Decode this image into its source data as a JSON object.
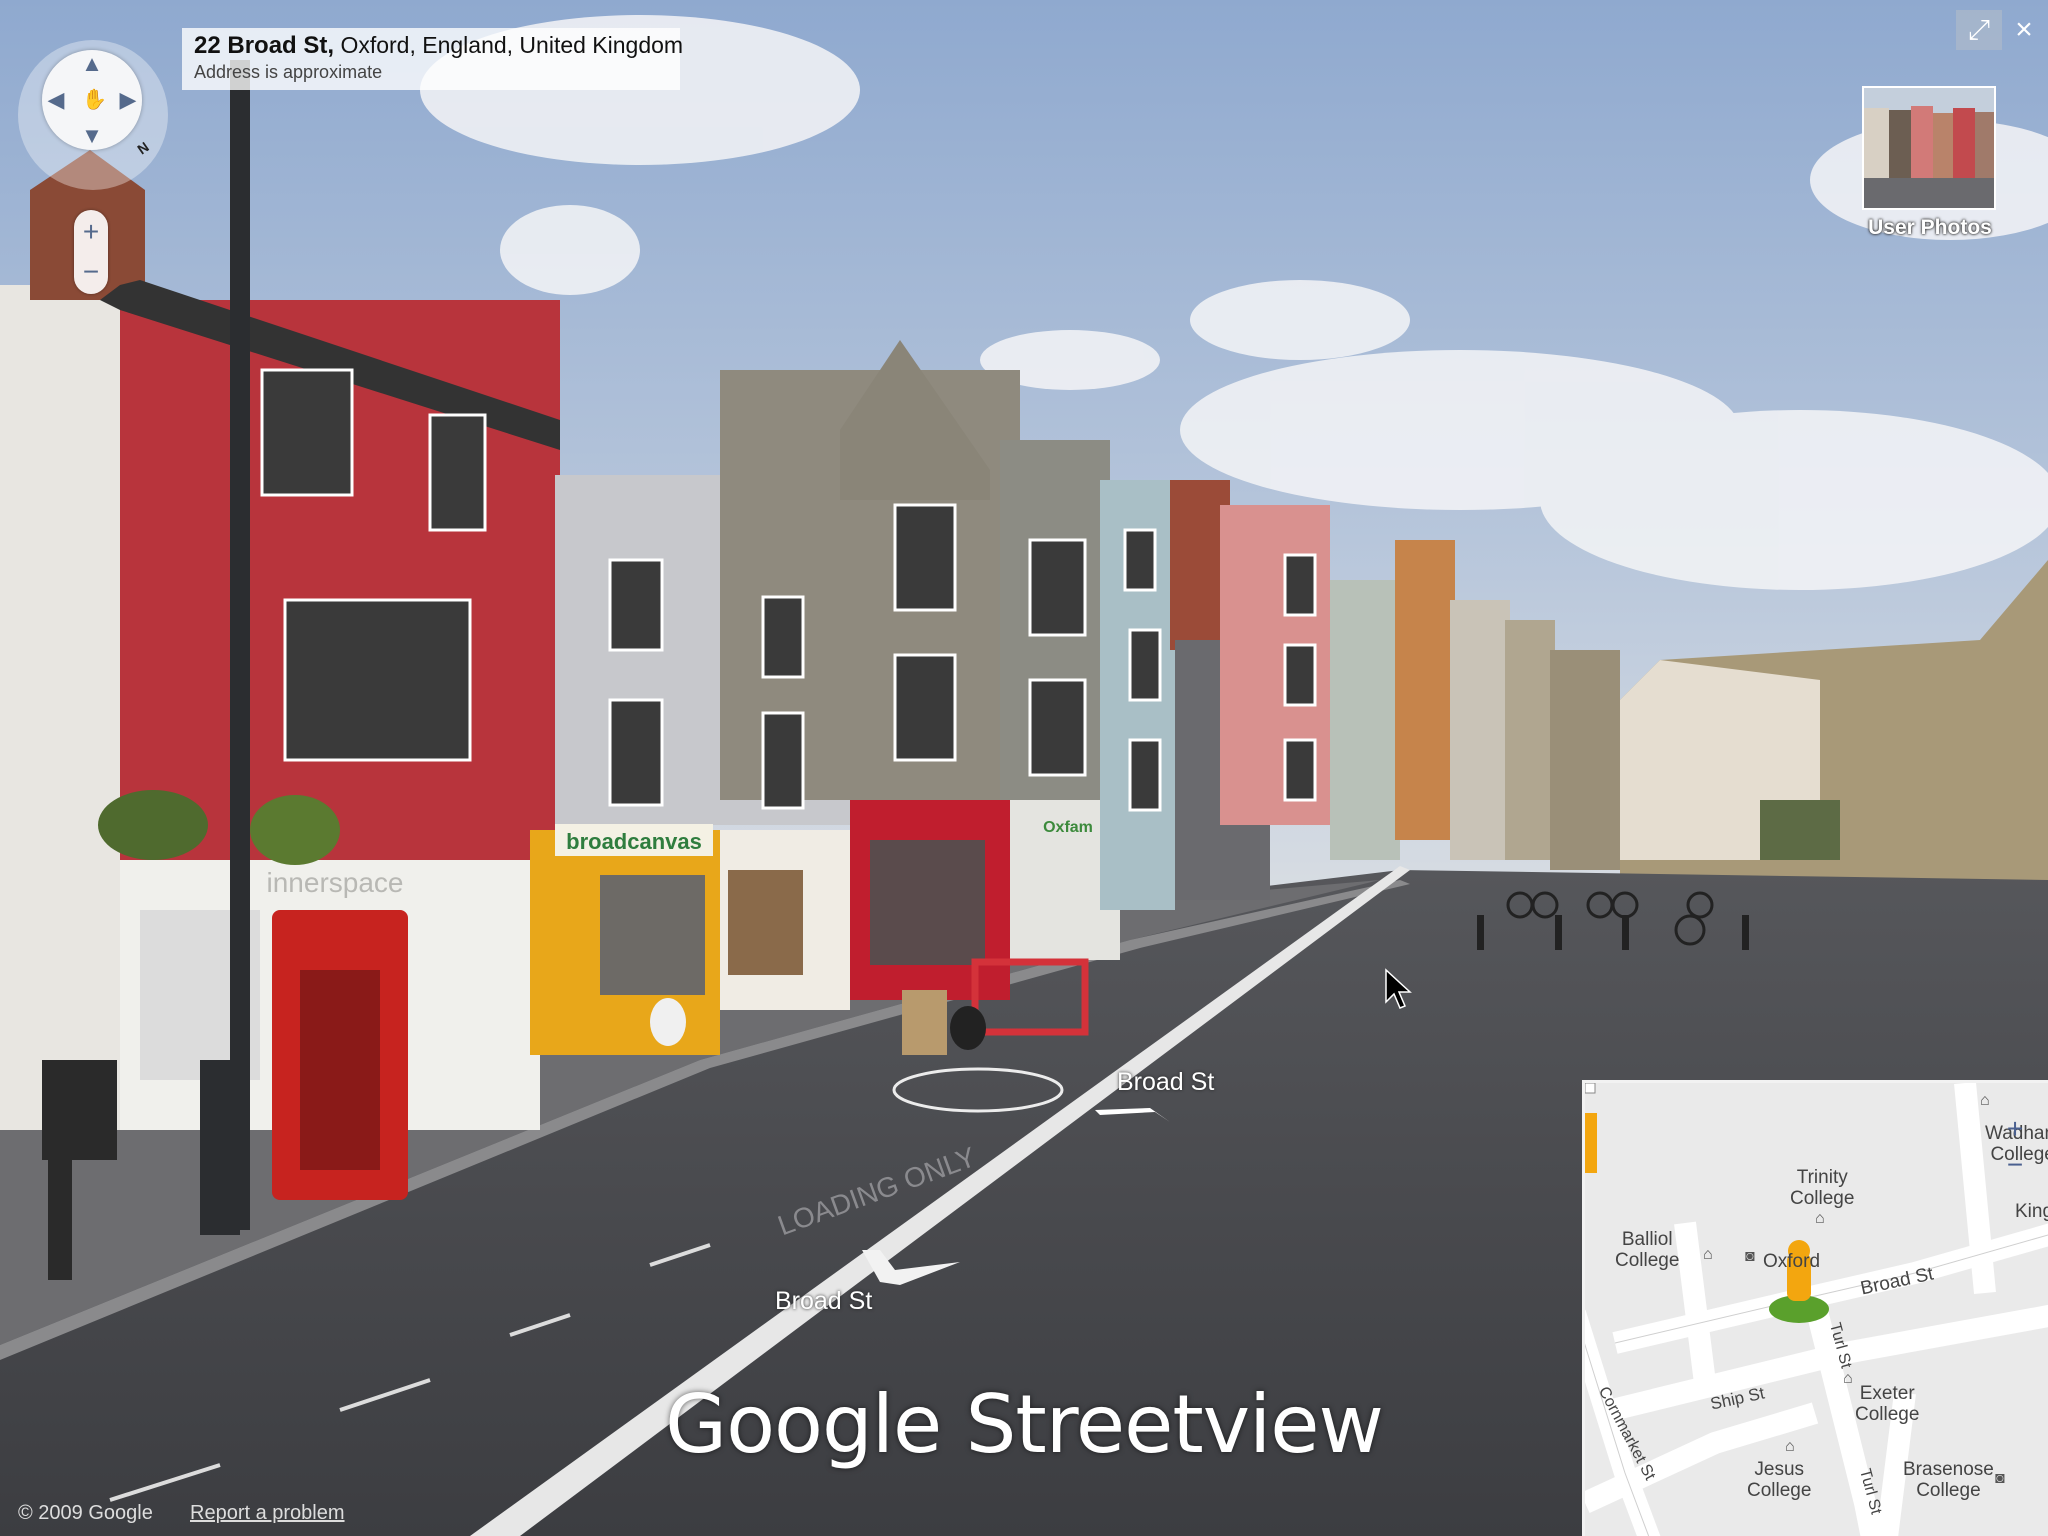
{
  "address": {
    "street": "22 Broad St,",
    "locality": "Oxford, England, United Kingdom",
    "note": "Address is approximate"
  },
  "nav": {
    "compass_north": "N",
    "pan_up": "▲",
    "pan_down": "▼",
    "pan_left": "◀",
    "pan_right": "▶",
    "zoom_in": "+",
    "zoom_out": "−"
  },
  "controls": {
    "fullscreen_icon": "⤢",
    "close_icon": "×"
  },
  "user_photos": {
    "label": "User Photos"
  },
  "scene": {
    "road_label_far": "Broad St",
    "road_label_near": "Broad St",
    "shop_sign_1": "broadcanvas",
    "shop_sign_2": "innerspace",
    "shop_sign_3": "Oxfam",
    "road_marking": "LOADING ONLY"
  },
  "caption": "Google Streetview",
  "footer": {
    "copyright": "© 2009 Google",
    "report": "Report a problem"
  },
  "minimap": {
    "zoom_in": "+",
    "zoom_out": "−",
    "labels": {
      "trinity": "Trinity\nCollege",
      "balliol": "Balliol\nCollege",
      "oxford": "Oxford",
      "broad": "Broad St",
      "turl": "Turl St",
      "turl2": "Turl St",
      "ship": "Ship St",
      "exeter": "Exeter\nCollege",
      "cornmarket": "Cornmarket St",
      "jesus": "Jesus\nCollege",
      "brasenose": "Brasenose\nCollege",
      "wadham": "Wadham\nCollege",
      "kings": "Kings"
    }
  },
  "colors": {
    "sky": "#9fb6d6",
    "road": "#4a4b4f",
    "red_building": "#b8343c",
    "phone_box": "#c7231f",
    "yellow_shop": "#e8a71a",
    "map_bg": "#eaeaea",
    "pegman": "#f3a60f"
  }
}
